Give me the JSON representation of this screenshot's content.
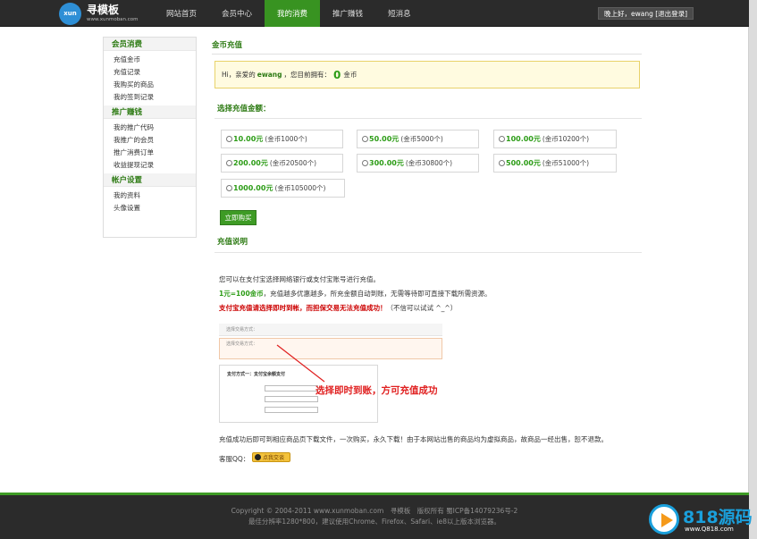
{
  "logo": {
    "badge": "xun",
    "name": "寻模板",
    "url": "www.xunmoban.com"
  },
  "nav": [
    {
      "label": "网站首页"
    },
    {
      "label": "会员中心"
    },
    {
      "label": "我的消费",
      "active": true
    },
    {
      "label": "推广赚钱"
    },
    {
      "label": "短消息"
    }
  ],
  "user": {
    "greeting": "晚上好，ewang [退出登录]"
  },
  "sidebar": {
    "groups": [
      {
        "title": "会员消费",
        "items": [
          "充值金币",
          "充值记录",
          "我购买的商品",
          "我的签到记录"
        ]
      },
      {
        "title": "推广赚钱",
        "items": [
          "我的推广代码",
          "我推广的会员",
          "推广消费订单",
          "收益提现记录"
        ]
      },
      {
        "title": "帐户设置",
        "items": [
          "我的资料",
          "头像设置"
        ]
      }
    ]
  },
  "main": {
    "title": "金币充值",
    "notice": {
      "prefix": "Hi，亲爱的",
      "user": "ewang",
      "middle": "，您目前拥有：",
      "coins": "0",
      "unit": "金币"
    },
    "choose_title": "选择充值金额：",
    "options": [
      {
        "price": "10.00元",
        "coins": "(金币1000个)"
      },
      {
        "price": "50.00元",
        "coins": "(金币5000个)"
      },
      {
        "price": "100.00元",
        "coins": "(金币10200个)"
      },
      {
        "price": "200.00元",
        "coins": "(金币20500个)"
      },
      {
        "price": "300.00元",
        "coins": "(金币30800个)"
      },
      {
        "price": "500.00元",
        "coins": "(金币51000个)"
      },
      {
        "price": "1000.00元",
        "coins": "(金币105000个)"
      }
    ],
    "buy_label": "立即购买",
    "desc_title": "充值说明",
    "desc": {
      "line1": "您可以在支付宝选择网络银行或支付宝账号进行充值。",
      "line2_bold": "1元=100金币",
      "line2_rest": "，充值越多优惠越多，所充金额自动到账，无需等待即可直接下载所需资源。",
      "line3_bold": "支付宝充值请选择即时到帐，而担保交易无法充值成功！",
      "line3_rest": "（不信可以试试 ^_^）",
      "line4": "充值成功后即可到相应商品页下载文件，一次购买，永久下载！由于本网站出售的商品均为虚拟商品，故商品一经出售，恕不退款。",
      "qq_label": "客服QQ：",
      "qq_badge": "点我交谈"
    },
    "illustration": {
      "caption": "选择即时到账，方可充值成功",
      "row1": "选择交易方式：",
      "row2": "选择交易方式：",
      "row3": "支付方式一：支付宝余额支付"
    }
  },
  "footer": {
    "line1": "Copyright © 2004-2011 www.xunmoban.com　寻模板　版权所有 蜀ICP备14079236号-2",
    "line2": "最佳分辨率1280*800，建议使用Chrome、Firefox、Safari、ie8以上版本浏览器。"
  },
  "watermark": {
    "text": "818源码",
    "url": "www.Q818.com"
  },
  "colors": {
    "green": "#3e9b25",
    "dark": "#2b2b2b",
    "accent_text": "#2c7a12"
  }
}
